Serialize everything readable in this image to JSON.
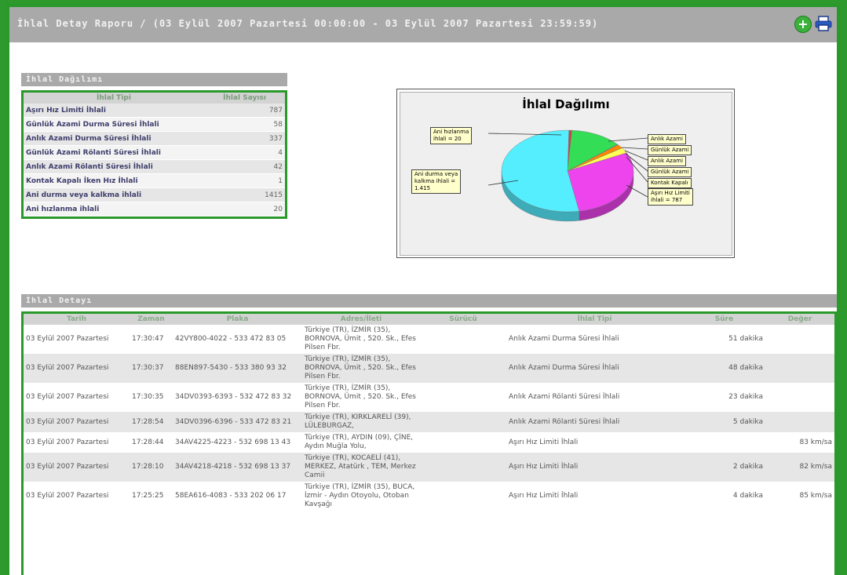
{
  "title": "İhlal Detay Raporu / (03 Eylül 2007 Pazartesi 00:00:00 - 03 Eylül 2007 Pazartesi 23:59:59)",
  "toolbar": {
    "add_icon": "add-icon",
    "print_icon": "print-icon"
  },
  "colors": {
    "frame": "#2a982a",
    "header": "#a9a9a9"
  },
  "summary": {
    "header": "İhlal Dağılımı",
    "columns": [
      "İhlal Tipi",
      "İhlal Sayısı"
    ],
    "rows": [
      {
        "type": "Aşırı Hız Limiti İhlali",
        "count": "787"
      },
      {
        "type": "Günlük Azami Durma Süresi İhlali",
        "count": "58"
      },
      {
        "type": "Anlık Azami Durma Süresi İhlali",
        "count": "337"
      },
      {
        "type": "Günlük Azami Rölanti Süresi İhlali",
        "count": "4"
      },
      {
        "type": "Anlık Azami Rölanti Süresi İhlali",
        "count": "42"
      },
      {
        "type": "Kontak Kapalı İken Hız İhlali",
        "count": "1"
      },
      {
        "type": "Ani durma veya kalkma ihlali",
        "count": "1415"
      },
      {
        "type": "Ani hızlanma ihlali",
        "count": "20"
      }
    ]
  },
  "chart_data": {
    "type": "pie",
    "title": "İhlal Dağılımı",
    "categories": [
      "Aşırı Hız Limiti İhlali",
      "Günlük Azami Durma Süresi İhlali",
      "Anlık Azami Durma Süresi İhlali",
      "Günlük Azami Rölanti Süresi İhlali",
      "Anlık Azami Rölanti Süresi İhlali",
      "Kontak Kapalı İken Hız İhlali",
      "Ani durma veya kalkma ihlali",
      "Ani hızlanma ihlali"
    ],
    "values": [
      787,
      58,
      337,
      4,
      42,
      1,
      1415,
      20
    ],
    "colors": [
      "#ee44ee",
      "#ffff55",
      "#33dd55",
      "#3333ff",
      "#ff8800",
      "#ffffff",
      "#55eeff",
      "#cc4444"
    ],
    "callouts": [
      {
        "text": "Ani hızlanma\nihlali = 20"
      },
      {
        "text": "Ani durma veya\nkalkma ihlali =\n1.415"
      },
      {
        "text": "Anlık Azami"
      },
      {
        "text": "Günlük Azami"
      },
      {
        "text": "Anlık Azami"
      },
      {
        "text": "Günlük Azami"
      },
      {
        "text": "Kontak Kapalı"
      },
      {
        "text": "Aşırı Hız Limiti\nihlali = 787"
      }
    ]
  },
  "detail": {
    "header": "İhlal Detayı",
    "columns": [
      "Tarih",
      "Zaman",
      "Plaka",
      "Adres/İleti",
      "Sürücü",
      "İhlal Tipi",
      "Süre",
      "Değer"
    ],
    "rows": [
      {
        "tarih": "03 Eylül 2007 Pazartesi",
        "zaman": "17:30:47",
        "plaka": "42VY800-4022 - 533 472 83 05",
        "adres": "Türkiye (TR), İZMİR (35), BORNOVA, Ümit , 520. Sk., Efes Pilsen Fbr.",
        "surucu": "",
        "tip": "Anlık Azami Durma Süresi İhlali",
        "sure": "51 dakika",
        "deger": ""
      },
      {
        "tarih": "03 Eylül 2007 Pazartesi",
        "zaman": "17:30:37",
        "plaka": "88EN897-5430 - 533 380 93 32",
        "adres": "Türkiye (TR), İZMİR (35), BORNOVA, Ümit , 520. Sk., Efes Pilsen Fbr.",
        "surucu": "",
        "tip": "Anlık Azami Durma Süresi İhlali",
        "sure": "48 dakika",
        "deger": ""
      },
      {
        "tarih": "03 Eylül 2007 Pazartesi",
        "zaman": "17:30:35",
        "plaka": "34DV0393-6393 - 532 472 83 32",
        "adres": "Türkiye (TR), İZMİR (35), BORNOVA, Ümit , 520. Sk., Efes Pilsen Fbr.",
        "surucu": "",
        "tip": "Anlık Azami Rölanti Süresi İhlali",
        "sure": "23 dakika",
        "deger": ""
      },
      {
        "tarih": "03 Eylül 2007 Pazartesi",
        "zaman": "17:28:54",
        "plaka": "34DV0396-6396 - 533 472 83 21",
        "adres": "Türkiye (TR), KIRKLARELİ (39), LÜLEBURGAZ,",
        "surucu": "",
        "tip": "Anlık Azami Rölanti Süresi İhlali",
        "sure": "5 dakika",
        "deger": ""
      },
      {
        "tarih": "03 Eylül 2007 Pazartesi",
        "zaman": "17:28:44",
        "plaka": "34AV4225-4223 - 532 698 13 43",
        "adres": "Türkiye (TR), AYDIN (09), ÇİNE, Aydın Muğla Yolu,",
        "surucu": "",
        "tip": "Aşırı Hız Limiti İhlali",
        "sure": "",
        "deger": "83 km/sa"
      },
      {
        "tarih": "03 Eylül 2007 Pazartesi",
        "zaman": "17:28:10",
        "plaka": "34AV4218-4218 - 532 698 13 37",
        "adres": "Türkiye (TR), KOCAELİ (41), MERKEZ, Atatürk , TEM, Merkez Camii",
        "surucu": "",
        "tip": "Aşırı Hız Limiti İhlali",
        "sure": "2 dakika",
        "deger": "82 km/sa"
      },
      {
        "tarih": "03 Eylül 2007 Pazartesi",
        "zaman": "17:25:25",
        "plaka": "58EA616-4083 - 533 202 06 17",
        "adres": "Türkiye (TR), İZMİR (35), BUCA, İzmir - Aydın Otoyolu, Otoban Kavşağı",
        "surucu": "",
        "tip": "Aşırı Hız Limiti İhlali",
        "sure": "4 dakika",
        "deger": "85 km/sa"
      }
    ]
  }
}
